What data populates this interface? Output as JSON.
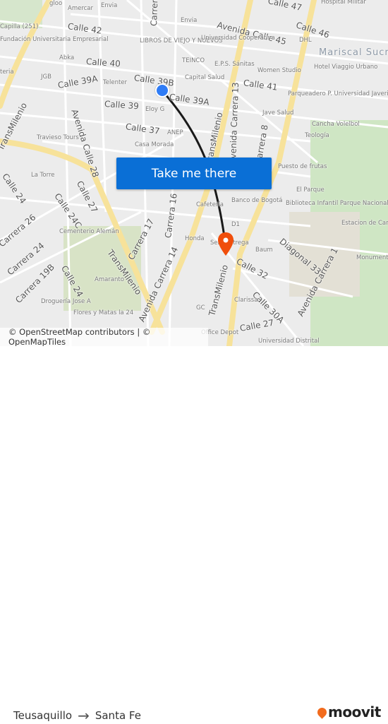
{
  "map": {
    "streets": [
      "Calle 42",
      "Avenida Calle 45",
      "Calle 46",
      "Calle 40",
      "Calle 39B",
      "Calle 39A",
      "Calle 39A",
      "Calle 41",
      "Calle 39",
      "Calle 37",
      "Avenida Calle 28",
      "TransMilenio",
      "Avenida Carrera 13",
      "Carrera 8",
      "TransMilenio",
      "Calle 24",
      "Calle 27",
      "Calle 24C",
      "Carrera 26",
      "Carrera 24",
      "Carrera 19B",
      "Calle 24",
      "TransMilenio",
      "Carrera 17",
      "Carrera 16",
      "Avenida Carrera 14",
      "TransMilenio",
      "Calle 32",
      "Diagonal 33",
      "Calle 30A",
      "Avenida Carrera 1",
      "Calle 27",
      "Carrera",
      "Calle 47"
    ],
    "pois": [
      "gloo",
      "Amercar",
      "Envia",
      "Envia",
      "Capilla (251)",
      "Fundación Universitaria Empresarial",
      "LIBROS DE VIEJO Y NUEVOS",
      "Universidad Cooperativa",
      "DHL",
      "Abka",
      "TEINCO",
      "E.P.S. Sánitas",
      "Women Studio",
      "Hotel Viaggio Urbano",
      "JGB",
      "Telenter",
      "Capital Salud",
      "Parqueadero P. Universidad Javeriana",
      "Eloy G",
      "Jave Salud",
      "Cancha Volelbol",
      "Teología",
      "ANEP",
      "Travieso Tours",
      "Casa Morada",
      "Puesto de frutas",
      "La Torre",
      "El Parque",
      "Banco de Bogotá",
      "Cafetería",
      "Biblioteca Infantil Parque Nacional",
      "D1",
      "Estacion de Carabineros Parque Nacional",
      "Cementerio Alemán",
      "Honda",
      "Servientrega",
      "Baum",
      "Monumento al Silencio",
      "Amaranto",
      "Droguería Jose A",
      "Flores y Matas la 24",
      "GC",
      "Clarissa",
      "Office Depot",
      "Universidad Distrital",
      "Hospital Militar",
      "teria"
    ],
    "districts": [
      "Mariscal Sucre"
    ],
    "cta_label": "Take me there",
    "attribution": "© OpenStreetMap contributors | © OpenMapTiles",
    "origin_marker_color": "#2f7cf6",
    "destination_marker_color": "#f04e0b",
    "route_line_color": "#1a1a1a"
  },
  "footer": {
    "origin": "Teusaquillo",
    "arrow": "→",
    "destination": "Santa Fe",
    "brand": "moovit",
    "brand_color": "#f26b1d"
  }
}
